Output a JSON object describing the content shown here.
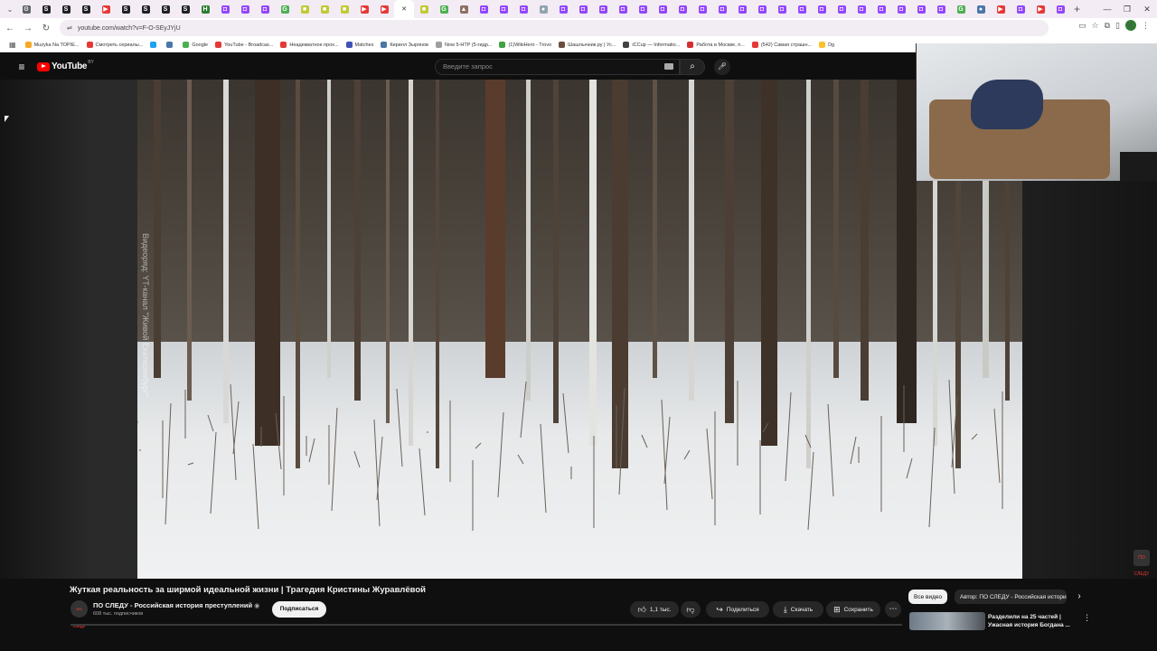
{
  "browser": {
    "url": "youtube.com/watch?v=F-O-SEyJYjU",
    "tab_favicons": [
      {
        "icon": "generic-icon",
        "color": "#5f6368",
        "glyph": "⚙"
      },
      {
        "icon": "s-icon",
        "color": "#202124",
        "glyph": "S"
      },
      {
        "icon": "s-icon",
        "color": "#202124",
        "glyph": "S"
      },
      {
        "icon": "s-icon",
        "color": "#202124",
        "glyph": "S"
      },
      {
        "icon": "youtube-icon",
        "color": "#e53935",
        "glyph": "▶"
      },
      {
        "icon": "s-icon",
        "color": "#202124",
        "glyph": "S"
      },
      {
        "icon": "s-icon",
        "color": "#202124",
        "glyph": "S"
      },
      {
        "icon": "s-icon",
        "color": "#202124",
        "glyph": "S"
      },
      {
        "icon": "s-icon",
        "color": "#202124",
        "glyph": "S"
      },
      {
        "icon": "h-icon",
        "color": "#2e7d32",
        "glyph": "H"
      },
      {
        "icon": "twitch-icon",
        "color": "#9146ff",
        "glyph": "◘"
      },
      {
        "icon": "twitch-icon",
        "color": "#9146ff",
        "glyph": "◘"
      },
      {
        "icon": "twitch-icon",
        "color": "#9146ff",
        "glyph": "◘"
      },
      {
        "icon": "google-icon",
        "color": "#4caf50",
        "glyph": "G"
      },
      {
        "icon": "folder-icon",
        "color": "#c0ca33",
        "glyph": "■"
      },
      {
        "icon": "folder-icon",
        "color": "#c0ca33",
        "glyph": "■"
      },
      {
        "icon": "folder-icon",
        "color": "#c0ca33",
        "glyph": "■"
      },
      {
        "icon": "youtube-icon",
        "color": "#e53935",
        "glyph": "▶"
      },
      {
        "icon": "youtube-icon",
        "color": "#e53935",
        "glyph": "▶"
      },
      {
        "icon": "close-icon",
        "color": "#ffffff",
        "glyph": "✕"
      },
      {
        "icon": "folder-icon",
        "color": "#c0ca33",
        "glyph": "■"
      },
      {
        "icon": "google-icon",
        "color": "#4caf50",
        "glyph": "G"
      },
      {
        "icon": "person-icon",
        "color": "#8d6e63",
        "glyph": "▲"
      },
      {
        "icon": "twitch-icon",
        "color": "#9146ff",
        "glyph": "◘"
      },
      {
        "icon": "twitch-icon",
        "color": "#9146ff",
        "glyph": "◘"
      },
      {
        "icon": "twitch-icon",
        "color": "#9146ff",
        "glyph": "◘"
      },
      {
        "icon": "circle-icon",
        "color": "#90a4ae",
        "glyph": "●"
      },
      {
        "icon": "twitch-icon",
        "color": "#9146ff",
        "glyph": "◘"
      },
      {
        "icon": "twitch-icon",
        "color": "#9146ff",
        "glyph": "◘"
      },
      {
        "icon": "twitch-icon",
        "color": "#9146ff",
        "glyph": "◘"
      },
      {
        "icon": "twitch-icon",
        "color": "#9146ff",
        "glyph": "◘"
      },
      {
        "icon": "twitch-icon",
        "color": "#9146ff",
        "glyph": "◘"
      },
      {
        "icon": "twitch-icon",
        "color": "#9146ff",
        "glyph": "◘"
      },
      {
        "icon": "twitch-icon",
        "color": "#9146ff",
        "glyph": "◘"
      },
      {
        "icon": "twitch-icon",
        "color": "#9146ff",
        "glyph": "◘"
      },
      {
        "icon": "twitch-icon",
        "color": "#9146ff",
        "glyph": "◘"
      },
      {
        "icon": "twitch-icon",
        "color": "#9146ff",
        "glyph": "◘"
      },
      {
        "icon": "twitch-icon",
        "color": "#9146ff",
        "glyph": "◘"
      },
      {
        "icon": "twitch-icon",
        "color": "#9146ff",
        "glyph": "◘"
      },
      {
        "icon": "twitch-icon",
        "color": "#9146ff",
        "glyph": "◘"
      },
      {
        "icon": "twitch-icon",
        "color": "#9146ff",
        "glyph": "◘"
      },
      {
        "icon": "twitch-icon",
        "color": "#9146ff",
        "glyph": "◘"
      },
      {
        "icon": "twitch-icon",
        "color": "#9146ff",
        "glyph": "◘"
      },
      {
        "icon": "twitch-icon",
        "color": "#9146ff",
        "glyph": "◘"
      },
      {
        "icon": "twitch-icon",
        "color": "#9146ff",
        "glyph": "◘"
      },
      {
        "icon": "twitch-icon",
        "color": "#9146ff",
        "glyph": "◘"
      },
      {
        "icon": "twitch-icon",
        "color": "#9146ff",
        "glyph": "◘"
      },
      {
        "icon": "google-icon",
        "color": "#4caf50",
        "glyph": "G"
      },
      {
        "icon": "vk-icon",
        "color": "#4a76a8",
        "glyph": "●"
      },
      {
        "icon": "youtube-icon",
        "color": "#e53935",
        "glyph": "▶"
      },
      {
        "icon": "twitch-icon",
        "color": "#9146ff",
        "glyph": "◘"
      },
      {
        "icon": "youtube-icon",
        "color": "#e53935",
        "glyph": "▶"
      },
      {
        "icon": "twitch-icon",
        "color": "#9146ff",
        "glyph": "◘"
      }
    ],
    "bookmarks": [
      {
        "label": "Muzyka Na TOPIE...",
        "color": "#f9a825"
      },
      {
        "label": "Смотреть сериалы...",
        "color": "#e53935"
      },
      {
        "label": "",
        "color": "#1da1f2"
      },
      {
        "label": "",
        "color": "#4a76a8"
      },
      {
        "label": "Google",
        "color": "#4caf50"
      },
      {
        "label": "YouTube - Broadcas...",
        "color": "#e53935"
      },
      {
        "label": "Неадекватное прох...",
        "color": "#e53935"
      },
      {
        "label": "Matches",
        "color": "#3f51b5"
      },
      {
        "label": "Кирилл Зырянов",
        "color": "#4a76a8"
      },
      {
        "label": "Now 5-HTP (5-гидр...",
        "color": "#9e9e9e"
      },
      {
        "label": "(1)WikiHero - Trovo",
        "color": "#43a047"
      },
      {
        "label": "Шашлычник.ру | Ус...",
        "color": "#6d4c41"
      },
      {
        "label": "iCCup — Informatio...",
        "color": "#424242"
      },
      {
        "label": "Работа в Москве, п...",
        "color": "#d32f2f"
      },
      {
        "label": "(542) Самая страшн...",
        "color": "#e53935"
      },
      {
        "label": "Dg",
        "color": "#fbc02d"
      }
    ]
  },
  "youtube": {
    "logo_text": "YouTube",
    "region": "BY",
    "search_placeholder": "Введите запрос"
  },
  "video": {
    "watermark": "Видеоряд: YT-канал \"Живой Екатеринбург\"",
    "title": "Жуткая реальность за ширмой идеальной жизни | Трагедия Кристины Журавлёвой",
    "channel_name": "ПО СЛЕДУ - Российская история преступлений",
    "subscribers": "608 тыс. подписчиков",
    "subscribe_label": "Подписаться",
    "likes": "1,1 тыс.",
    "share_label": "Поделиться",
    "download_label": "Скачать",
    "save_label": "Сохранить",
    "badge_text": "ПО СЛЕДУ"
  },
  "sidebar": {
    "chip_all": "Все видео",
    "chip_author": "Автор: ПО СЛЕДУ - Российская история преступлений",
    "rec_title": "Разделили на 25 частей | Ужасная история Богдана ..."
  }
}
